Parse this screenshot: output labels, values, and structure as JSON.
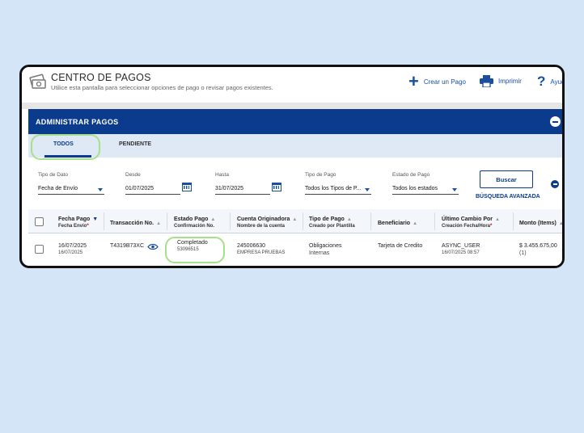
{
  "header": {
    "title": "CENTRO DE PAGOS",
    "subtitle": "Utilice esta pantalla para seleccionar opciones de pago o revisar pagos existentes.",
    "actions": {
      "crear": "Crear un Pago",
      "imprimir": "Imprimir",
      "ayuda": "Ayuda"
    }
  },
  "panel": {
    "title": "ADMINISTRAR PAGOS"
  },
  "tabs": {
    "todos": "TODOS",
    "pendiente": "PENDIENTE"
  },
  "filters": {
    "tipo_dato": {
      "label": "Tipo de Dato",
      "value": "Fecha de Envío"
    },
    "desde": {
      "label": "Desde",
      "value": "01/07/2025"
    },
    "hasta": {
      "label": "Hasta",
      "value": "31/07/2025"
    },
    "tipo_pago": {
      "label": "Tipo de Pago",
      "value": "Todos los Tipos de P..."
    },
    "estado_pago": {
      "label": "Estado de Pago",
      "value": "Todos los estados"
    },
    "buscar": "Buscar",
    "busqueda_avanzada": "BÚSQUEDA AVANZADA"
  },
  "table": {
    "columns": {
      "fecha_pago": {
        "label": "Fecha Pago",
        "sub": "Fecha Envío"
      },
      "transaccion": {
        "label": "Transacción No."
      },
      "estado_pago": {
        "label": "Estado Pago",
        "sub": "Confirmación No."
      },
      "cuenta": {
        "label": "Cuenta Originadora",
        "sub": "Nombre de la cuenta"
      },
      "tipo_pago": {
        "label": "Tipo de Pago",
        "sub": "Creado por Plantilla"
      },
      "beneficiario": {
        "label": "Beneficiario"
      },
      "ultimo_cambio": {
        "label": "Último Cambio Por",
        "sub": "Creación Fecha/Hora"
      },
      "monto": {
        "label": "Monto (Items)"
      }
    },
    "rows": [
      {
        "fecha_pago": "16/07/2025",
        "fecha_envio": "16/07/2025",
        "transaccion": "T4319B73XC",
        "estado": "Completado",
        "confirmacion": "53096515",
        "cuenta": "245006630",
        "nombre_cuenta": "EMPRESA PRUEBAS",
        "tipo_pago": "Obligaciones",
        "tipo_pago_2": "Internas",
        "beneficiario": "Tarjeta de Credito",
        "ultimo_cambio": "ASYNC_USER",
        "creacion": "16/07/2025 08:57",
        "monto": "$ 3.455.675,00",
        "items": "(1)"
      }
    ]
  },
  "colors": {
    "page_bg": "#d4e5f7",
    "brand_blue": "#0a3b8c",
    "tab_bg": "#dfe9f5",
    "highlight": "#a6e08a"
  }
}
